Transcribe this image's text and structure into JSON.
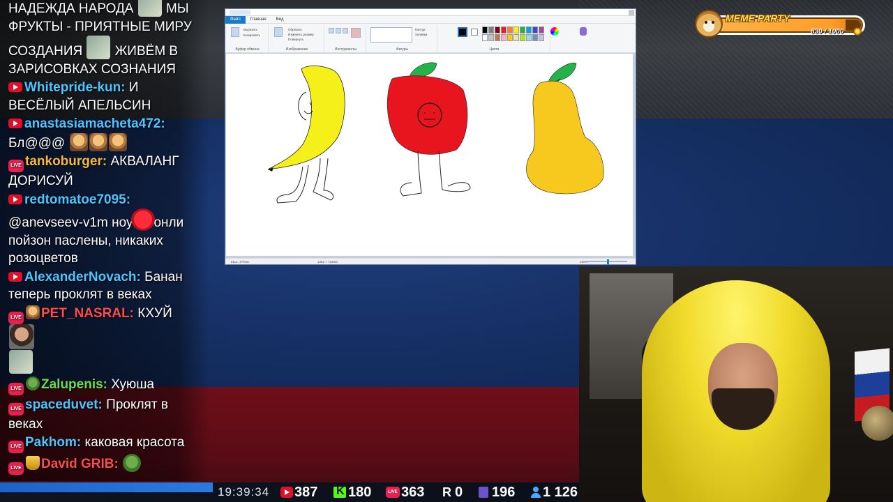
{
  "chat": {
    "messages": [
      {
        "platform": "",
        "user": "",
        "user_color": "#ffffff",
        "text": "НАДЕЖДА НАРОДА [emote] МЫ ФРУКТЫ - ПРИЯТНЫЕ МИРУ СОЗДАНИЯ [emote] ЖИВЁМ В ЗАРИСОВКАХ СОЗНАНИЯ"
      },
      {
        "platform": "youtube",
        "user": "Whitepride-kun:",
        "user_color": "#4ec5ff",
        "text": "И ВЕСЁЛЫЙ АПЕЛЬСИН"
      },
      {
        "platform": "youtube",
        "user": "anastasiamacheta472:",
        "user_color": "#4ec5ff",
        "text": "Бл@@@"
      },
      {
        "platform": "vklive",
        "user": "tankoburger:",
        "user_color": "#f5b93a",
        "text": "АКВАЛАНГ ДОРИСУЙ"
      },
      {
        "platform": "youtube",
        "user": "redtomatoe7095:",
        "user_color": "#4ec5ff",
        "text_before": "@anevseev-v1m ноу",
        "text_after": "онли пойзон паслены, никаких розоцветов"
      },
      {
        "platform": "youtube",
        "user": "AlexanderNovach:",
        "user_color": "#4ec5ff",
        "text": "Банан теперь проклят в веках"
      },
      {
        "platform": "vklive",
        "user": "PET_NASRAL:",
        "user_color": "#ff4b4b",
        "text": "КХУЙ"
      },
      {
        "platform": "vklive",
        "user": "Zalupenis:",
        "user_color": "#6ddc4a",
        "text": "Хуюша"
      },
      {
        "platform": "vklive",
        "user": "spaceduvet:",
        "user_color": "#4ec5ff",
        "text": "Проклят в веках"
      },
      {
        "platform": "vklive",
        "user": "Pakhom:",
        "user_color": "#4ec5ff",
        "text": "каковая красота"
      },
      {
        "platform": "vklive",
        "user": "David GRIB:",
        "user_color": "#ff4b4b",
        "text": ""
      }
    ]
  },
  "paint": {
    "tabs": [
      "Файл",
      "Главная",
      "Вид"
    ],
    "groups": [
      "Буфер обмена",
      "Изображение",
      "Инструменты",
      "Фигуры",
      "Цвета"
    ],
    "status_left": "8112, 476пкс",
    "status_mid": "1351 × 723пкс",
    "status_zoom": "100%",
    "palette": [
      "#000000",
      "#7f7f7f",
      "#880015",
      "#ed1c24",
      "#ff7f27",
      "#fff200",
      "#22b14c",
      "#00a2e8",
      "#3f48cc",
      "#a349a4",
      "#ffffff",
      "#c3c3c3",
      "#b97a57",
      "#ffaec9",
      "#ffc90e",
      "#efe4b0",
      "#b5e61d",
      "#99d9ea",
      "#7092be",
      "#c8bfe7"
    ]
  },
  "drawing": {
    "banana_color": "#f5f01a",
    "apple_color": "#e8141e",
    "leaf_color": "#24b24a",
    "pear_color": "#f7c81d"
  },
  "meme_party": {
    "title": "MEME PARTY",
    "progress": "830 / 1000"
  },
  "stats": {
    "time": "19:39:34",
    "youtube": "387",
    "kick": "180",
    "vklive": "363",
    "rutube": "0",
    "twitch": "196",
    "viewers": "1 126"
  }
}
